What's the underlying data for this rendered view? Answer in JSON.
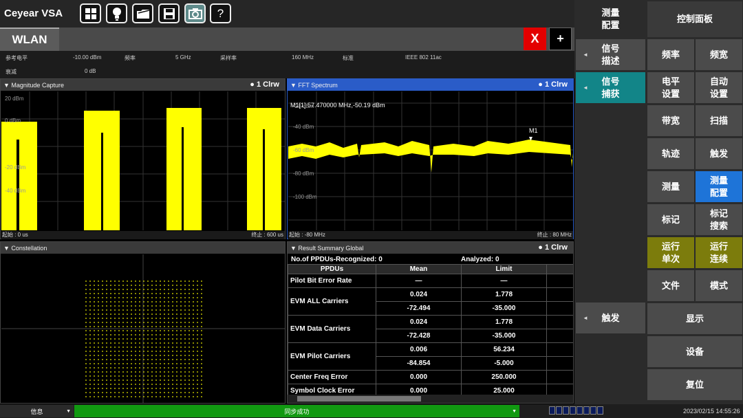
{
  "app": {
    "title": "Ceyear VSA"
  },
  "toolbar": {
    "icons": [
      "windows-icon",
      "lightbulb-icon",
      "folder-icon",
      "save-icon",
      "camera-icon",
      "help-icon"
    ],
    "help_label": "?"
  },
  "tabs": {
    "active": "WLAN",
    "close_label": "X",
    "add_label": "+"
  },
  "params": {
    "ref_level_label": "参考电平",
    "ref_level_value": "-10.00 dBm",
    "freq_label": "频率",
    "freq_value": "5 GHz",
    "sample_label": "采样率",
    "sample_value": "160 MHz",
    "standard_label": "标准",
    "standard_value": "IEEE 802 11ac",
    "atten_label": "衰减",
    "atten_value": "0 dB"
  },
  "mag": {
    "title": "▼ Magnitude Capture",
    "trace": "● 1 Clrw",
    "ylabels": [
      "20 dBm",
      "0 dBm",
      "-20 dBm",
      "-40 dBm"
    ],
    "start": "起始 : 0 us",
    "stop": "终止 : 600 us"
  },
  "fft": {
    "title": "▼ FFT Spectrum",
    "trace": "● 1 Clrw",
    "marker_readout": "M1[1]   57.470000 MHz,-50.19 dBm",
    "marker": "M1",
    "ylabels": [
      "-20 dBm",
      "-40 dBm",
      "-60 dBm",
      "-80 dBm",
      "-100 dBm"
    ],
    "start": "起始 : -80 MHz",
    "stop": "终止 : 80 MHz"
  },
  "const": {
    "title": "▼ Constellation"
  },
  "summary": {
    "title": "▼ Result Summary Global",
    "trace": "● 1 Clrw",
    "ppdu_recognized": "No.of PPDUs-Recognized:  0",
    "analyzed": "Analyzed:  0",
    "headers": [
      "PPDUs",
      "Mean",
      "Limit"
    ],
    "rows": [
      {
        "name": "Pilot Bit Error Rate",
        "v1": "—",
        "v2": "—"
      },
      {
        "name": "EVM ALL Carriers",
        "v1": "0.024",
        "v2": "1.778",
        "v3": "-72.494",
        "v4": "-35.000"
      },
      {
        "name": "EVM Data Carriers",
        "v1": "0.024",
        "v2": "1.778",
        "v3": "-72.428",
        "v4": "-35.000"
      },
      {
        "name": "EVM Pilot Carriers",
        "v1": "0.006",
        "v2": "56.234",
        "v3": "-84.854",
        "v4": "-5.000"
      },
      {
        "name": "Center Freq Error",
        "v1": "0.000",
        "v2": "250.000"
      },
      {
        "name": "Symbol Clock Error",
        "v1": "0.000",
        "v2": "25.000"
      }
    ]
  },
  "right": {
    "meas_config": "测量\n配置",
    "control_panel": "控制面板",
    "signal_desc": "信号\n描述",
    "signal_capture": "信号\n捕获",
    "trigger_left": "触发",
    "freq": "频率",
    "span": "频宽",
    "level": "电平\n设置",
    "auto": "自动\n设置",
    "bw": "带宽",
    "sweep": "扫描",
    "trace": "轨迹",
    "trigger": "触发",
    "measure": "测量",
    "meas_cfg2": "测量\n配置",
    "marker": "标记",
    "marker_search": "标记\n搜索",
    "single": "运行\n单次",
    "cont": "运行\n连续",
    "file": "文件",
    "mode": "模式",
    "display": "显示",
    "device": "设备",
    "reset": "复位"
  },
  "status": {
    "info": "信息",
    "message": "同步成功",
    "datetime": "2023/02/15 14:55:26",
    "colors": {
      "ok": "#119911",
      "accent": "#1e74d8",
      "trace": "#ffff00"
    }
  }
}
